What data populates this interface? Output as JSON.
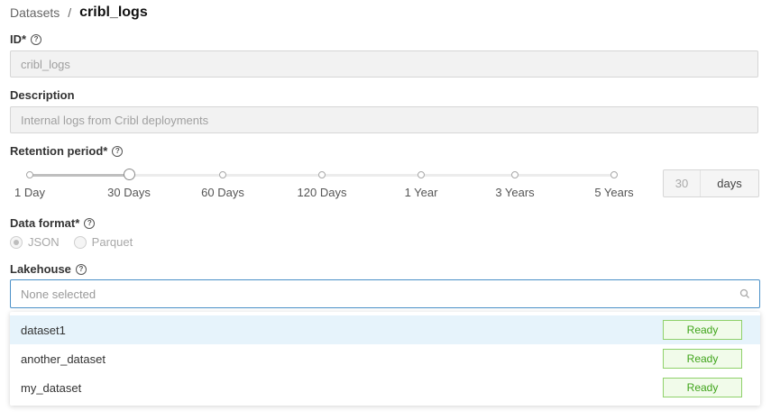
{
  "breadcrumb": {
    "parent": "Datasets",
    "separator": "/",
    "current": "cribl_logs"
  },
  "id_field": {
    "label": "ID*",
    "value": "cribl_logs"
  },
  "description_field": {
    "label": "Description",
    "value": "Internal logs from Cribl deployments"
  },
  "retention": {
    "label": "Retention period*",
    "options": [
      "1 Day",
      "30 Days",
      "60 Days",
      "120 Days",
      "1 Year",
      "3 Years",
      "5 Years"
    ],
    "selected": "30 Days",
    "value": "30",
    "unit": "days"
  },
  "data_format": {
    "label": "Data format*",
    "options": [
      "JSON",
      "Parquet"
    ],
    "selected": "JSON"
  },
  "lakehouse": {
    "label": "Lakehouse",
    "placeholder": "None selected",
    "options": [
      {
        "name": "dataset1",
        "status": "Ready",
        "highlighted": true
      },
      {
        "name": "another_dataset",
        "status": "Ready"
      },
      {
        "name": "my_dataset",
        "status": "Ready"
      }
    ]
  },
  "colors": {
    "accent": "#4a90c8",
    "ready_text": "#3fa41a",
    "ready_border": "#8fd16a",
    "highlight": "#e6f3fb"
  },
  "icons": {
    "help": "question-circle-icon",
    "search": "search-icon"
  }
}
